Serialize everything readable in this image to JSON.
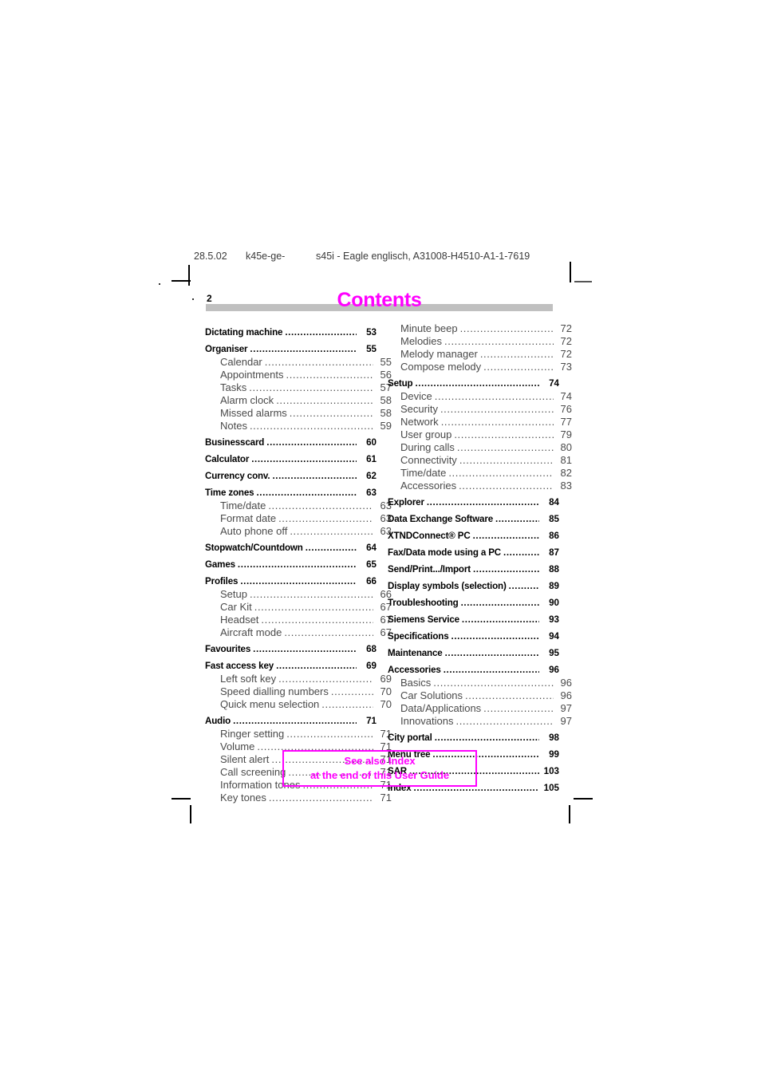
{
  "running_header": {
    "date": "28.5.02",
    "job": "k45e-ge-",
    "document": "s45i - Eagle englisch, A31008-H4510-A1-1-7619"
  },
  "page": {
    "folio": "2",
    "title": "Contents",
    "title_color": "#ff00ff",
    "band_color": "#c0c0c0"
  },
  "toc": {
    "left_column": [
      {
        "level": 1,
        "label": "Dictating machine",
        "page": "53"
      },
      {
        "level": 1,
        "label": "Organiser",
        "page": "55"
      },
      {
        "level": 2,
        "label": "Calendar",
        "page": "55"
      },
      {
        "level": 2,
        "label": "Appointments",
        "page": "56"
      },
      {
        "level": 2,
        "label": "Tasks",
        "page": "57"
      },
      {
        "level": 2,
        "label": "Alarm clock",
        "page": "58"
      },
      {
        "level": 2,
        "label": "Missed alarms",
        "page": "58"
      },
      {
        "level": 2,
        "label": "Notes",
        "page": "59"
      },
      {
        "level": 1,
        "label": "Businesscard",
        "page": "60"
      },
      {
        "level": 1,
        "label": "Calculator",
        "page": "61"
      },
      {
        "level": 1,
        "label": "Currency conv.",
        "page": "62"
      },
      {
        "level": 1,
        "label": "Time zones",
        "page": "63"
      },
      {
        "level": 2,
        "label": "Time/date",
        "page": "63"
      },
      {
        "level": 2,
        "label": "Format date",
        "page": "63"
      },
      {
        "level": 2,
        "label": "Auto phone off",
        "page": "63"
      },
      {
        "level": 1,
        "label": "Stopwatch/Countdown",
        "page": "64"
      },
      {
        "level": 1,
        "label": "Games",
        "page": "65"
      },
      {
        "level": 1,
        "label": "Profiles",
        "page": "66"
      },
      {
        "level": 2,
        "label": "Setup",
        "page": "66"
      },
      {
        "level": 2,
        "label": "Car Kit",
        "page": "67"
      },
      {
        "level": 2,
        "label": "Headset",
        "page": "67"
      },
      {
        "level": 2,
        "label": "Aircraft mode",
        "page": "67"
      },
      {
        "level": 1,
        "label": "Favourites",
        "page": "68"
      },
      {
        "level": 1,
        "label": "Fast access key",
        "page": "69"
      },
      {
        "level": 2,
        "label": "Left soft key",
        "page": "69"
      },
      {
        "level": 2,
        "label": "Speed dialling numbers",
        "page": "70"
      },
      {
        "level": 2,
        "label": "Quick menu selection",
        "page": "70"
      },
      {
        "level": 1,
        "label": "Audio",
        "page": "71"
      },
      {
        "level": 2,
        "label": "Ringer setting",
        "page": "71"
      },
      {
        "level": 2,
        "label": "Volume",
        "page": "71"
      },
      {
        "level": 2,
        "label": "Silent alert",
        "page": "71"
      },
      {
        "level": 2,
        "label": "Call screening",
        "page": "71"
      },
      {
        "level": 2,
        "label": "Information tones",
        "page": "71"
      },
      {
        "level": 2,
        "label": "Key tones",
        "page": "71"
      }
    ],
    "right_column": [
      {
        "level": 2,
        "label": "Minute beep",
        "page": "72"
      },
      {
        "level": 2,
        "label": "Melodies",
        "page": "72"
      },
      {
        "level": 2,
        "label": "Melody manager",
        "page": "72"
      },
      {
        "level": 2,
        "label": "Compose melody",
        "page": "73"
      },
      {
        "level": 1,
        "label": "Setup",
        "page": "74"
      },
      {
        "level": 2,
        "label": "Device",
        "page": "74"
      },
      {
        "level": 2,
        "label": "Security",
        "page": "76"
      },
      {
        "level": 2,
        "label": "Network",
        "page": "77"
      },
      {
        "level": 2,
        "label": "User group",
        "page": "79"
      },
      {
        "level": 2,
        "label": "During calls",
        "page": "80"
      },
      {
        "level": 2,
        "label": "Connectivity",
        "page": "81"
      },
      {
        "level": 2,
        "label": "Time/date",
        "page": "82"
      },
      {
        "level": 2,
        "label": "Accessories",
        "page": "83"
      },
      {
        "level": 1,
        "label": "Explorer",
        "page": "84"
      },
      {
        "level": 1,
        "label": "Data Exchange Software",
        "page": "85"
      },
      {
        "level": 1,
        "label": "XTNDConnect® PC",
        "page": "86"
      },
      {
        "level": 1,
        "label": "Fax/Data mode using a PC",
        "page": "87"
      },
      {
        "level": 1,
        "label": "Send/Print.../Import",
        "page": "88"
      },
      {
        "level": 1,
        "label": "Display symbols (selection)",
        "page": "89"
      },
      {
        "level": 1,
        "label": "Troubleshooting",
        "page": "90"
      },
      {
        "level": 1,
        "label": "Siemens Service",
        "page": "93"
      },
      {
        "level": 1,
        "label": "Specifications",
        "page": "94"
      },
      {
        "level": 1,
        "label": "Maintenance",
        "page": "95"
      },
      {
        "level": 1,
        "label": "Accessories",
        "page": "96"
      },
      {
        "level": 2,
        "label": "Basics",
        "page": "96"
      },
      {
        "level": 2,
        "label": "Car Solutions",
        "page": "96"
      },
      {
        "level": 2,
        "label": "Data/Applications",
        "page": "97"
      },
      {
        "level": 2,
        "label": "Innovations",
        "page": "97"
      },
      {
        "level": 1,
        "label": "City portal",
        "page": "98"
      },
      {
        "level": 1,
        "label": "Menu tree",
        "page": "99"
      },
      {
        "level": 1,
        "label": "SAR",
        "page": "103"
      },
      {
        "level": 1,
        "label": "Index",
        "page": "105"
      }
    ]
  },
  "note_box": {
    "border_color": "#ff00ff",
    "lines": [
      "See also Index",
      "at the end of this User Guide"
    ]
  }
}
